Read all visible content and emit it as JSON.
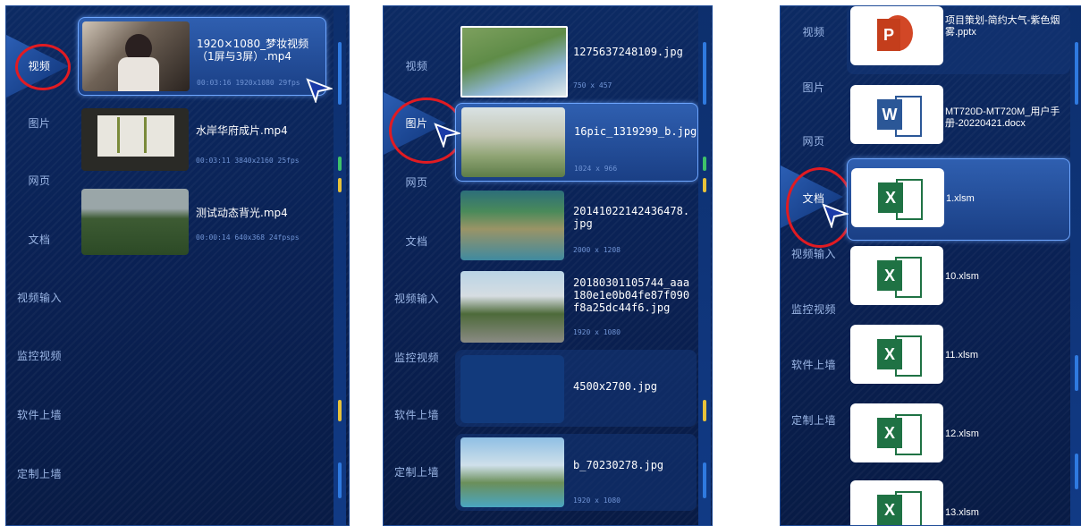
{
  "panels": [
    {
      "sidebar": [
        "视频",
        "图片",
        "网页",
        "文档",
        "视频输入",
        "监控视频",
        "软件上墙",
        "定制上墙"
      ],
      "active": "视频",
      "files": [
        {
          "name": "1920×1080_梦妆视频（1屏与3屏）.mp4",
          "meta": "00:03:16  1920x1080  29fps"
        },
        {
          "name": "水岸华府成片.mp4",
          "meta": "00:03:11  3840x2160  25fps"
        },
        {
          "name": "测试动态背光.mp4",
          "meta": "00:00:14  640x368  24fpsps"
        }
      ]
    },
    {
      "sidebar": [
        "视频",
        "图片",
        "网页",
        "文档",
        "视频输入",
        "监控视频",
        "软件上墙",
        "定制上墙"
      ],
      "active": "图片",
      "files": [
        {
          "name": "1275637248109.jpg",
          "meta": "750 x 457"
        },
        {
          "name": "16pic_1319299_b.jpg",
          "meta": "1024 x 966"
        },
        {
          "name": "20141022142436478.jpg",
          "meta": "2000 x 1208"
        },
        {
          "name": "20180301105744_aaa180e1e0b04fe87f090f8a25dc44f6.jpg",
          "meta": "1920 x 1080"
        },
        {
          "name": "4500x2700.jpg",
          "meta": ""
        },
        {
          "name": "b_70230278.jpg",
          "meta": "1920 x 1080"
        }
      ]
    },
    {
      "sidebar": [
        "视频",
        "图片",
        "网页",
        "文档",
        "视频输入",
        "监控视频",
        "软件上墙",
        "定制上墙"
      ],
      "active": "文档",
      "files": [
        {
          "name": "项目策划-简约大气-紫色烟雾.pptx",
          "icon": "powerpoint-icon"
        },
        {
          "name": "MT720D-MT720M_用户手册-20220421.docx",
          "icon": "word-icon"
        },
        {
          "name": "1.xlsm",
          "icon": "excel-icon"
        },
        {
          "name": "10.xlsm",
          "icon": "excel-icon"
        },
        {
          "name": "11.xlsm",
          "icon": "excel-icon"
        },
        {
          "name": "12.xlsm",
          "icon": "excel-icon"
        },
        {
          "name": "13.xlsm",
          "icon": "excel-icon"
        }
      ]
    }
  ],
  "colors": {
    "accent_red": "#e11b22",
    "select_border": "#6ea6ff",
    "excel": "#1f7244",
    "word": "#2b5797",
    "ppt": "#d24726"
  },
  "icons": {
    "pointer": "pointer-cursor-icon"
  }
}
